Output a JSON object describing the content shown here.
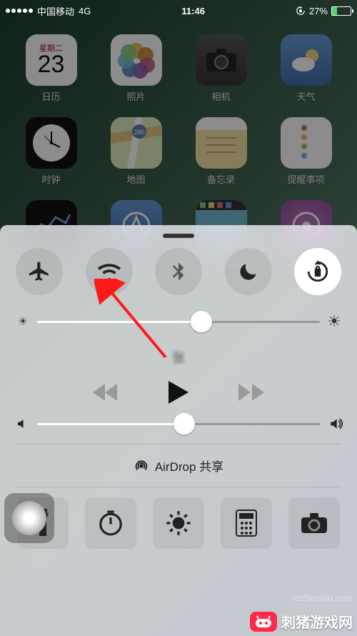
{
  "status": {
    "carrier": "中国移动",
    "network": "4G",
    "time": "11:46",
    "battery_pct": "27%",
    "battery_level": 27,
    "orientation_lock": true
  },
  "apps": {
    "row1": [
      {
        "label": "日历",
        "icon": "calendar",
        "weekday": "星期二",
        "day": "23"
      },
      {
        "label": "照片",
        "icon": "photos"
      },
      {
        "label": "相机",
        "icon": "camera"
      },
      {
        "label": "天气",
        "icon": "weather"
      }
    ],
    "row2": [
      {
        "label": "时钟",
        "icon": "clock"
      },
      {
        "label": "地图",
        "icon": "maps"
      },
      {
        "label": "备忘录",
        "icon": "notes"
      },
      {
        "label": "提醒事项",
        "icon": "reminders"
      }
    ],
    "row3_partial": [
      {
        "icon": "stocks"
      },
      {
        "icon": "store"
      },
      {
        "icon": "video"
      },
      {
        "icon": "itunes"
      }
    ]
  },
  "control_center": {
    "toggles": {
      "airplane": {
        "active": false,
        "name": "airplane-mode"
      },
      "wifi": {
        "active": false,
        "name": "wifi"
      },
      "bluetooth": {
        "active": false,
        "name": "bluetooth"
      },
      "dnd": {
        "active": false,
        "name": "do-not-disturb"
      },
      "orientation_lock": {
        "active": true,
        "name": "orientation-lock"
      }
    },
    "brightness": {
      "value_pct": 58
    },
    "media": {
      "title": "张",
      "playing": false
    },
    "volume": {
      "value_pct": 52
    },
    "airdrop_label": "AirDrop 共享",
    "quick": [
      {
        "name": "flashlight"
      },
      {
        "name": "timer"
      },
      {
        "name": "night-shift"
      },
      {
        "name": "calculator"
      },
      {
        "name": "camera"
      }
    ]
  },
  "annotation": {
    "arrow_target": "wifi-toggle",
    "arrow_color": "#ff1a1a"
  },
  "watermark": {
    "site_name": "刺猪游戏网",
    "url": "cizhuniao.com"
  }
}
